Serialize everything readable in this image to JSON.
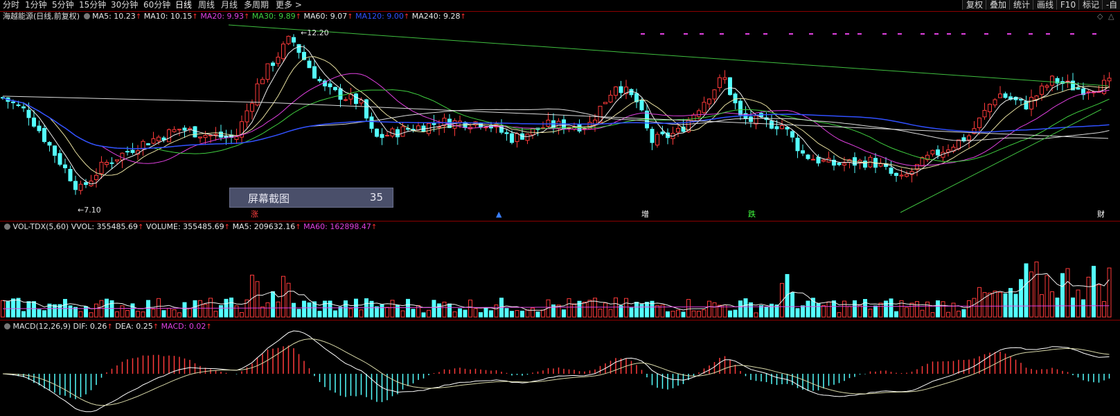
{
  "periods": [
    "分时",
    "1分钟",
    "5分钟",
    "15分钟",
    "30分钟",
    "60分钟",
    "日线",
    "周线",
    "月线",
    "多周期",
    "更多 >"
  ],
  "right_buttons": [
    "复权",
    "叠加",
    "统计",
    "画线",
    "F10",
    "标记",
    "-自"
  ],
  "price_legend": {
    "title": "海越能源(日线,前复权)",
    "ma": [
      {
        "label": "MA5: 10.23",
        "color": "#e8e8e8"
      },
      {
        "label": "MA10: 10.15",
        "color": "#e8e8e8"
      },
      {
        "label": "MA20: 9.93",
        "color": "#e040e0"
      },
      {
        "label": "MA30: 9.89",
        "color": "#40d040"
      },
      {
        "label": "MA60: 9.07",
        "color": "#e8e8e8"
      },
      {
        "label": "MA120: 9.00",
        "color": "#3050ff"
      },
      {
        "label": "MA240: 9.28",
        "color": "#e8e8e8"
      }
    ]
  },
  "high_label": "12.20",
  "low_label": "7.10",
  "screenshot_overlay": {
    "text": "屏幕截图",
    "number": "35"
  },
  "events": [
    {
      "label": "涨",
      "color": "#ff4040"
    },
    {
      "label": "▲",
      "color": "#3a7fff"
    },
    {
      "label": "增",
      "color": "#ffffff"
    },
    {
      "label": "跌",
      "color": "#40ff40"
    },
    {
      "label": "财",
      "color": "#ffffff"
    }
  ],
  "vol_legend": {
    "title": "VOL-TDX(5,60)",
    "items": [
      {
        "label": "VVOL: 355485.69",
        "color": "#e8e8e8"
      },
      {
        "label": "VOLUME: 355485.69",
        "color": "#e8e8e8"
      },
      {
        "label": "MA5: 209632.16",
        "color": "#e8e8e8"
      },
      {
        "label": "MA60: 162898.47",
        "color": "#e040e0"
      }
    ]
  },
  "macd_legend": {
    "title": "MACD(12,26,9)",
    "items": [
      {
        "label": "DIF: 0.26",
        "color": "#e8e8e8"
      },
      {
        "label": "DEA: 0.25",
        "color": "#e8e8e8"
      },
      {
        "label": "MACD: 0.02",
        "color": "#e040e0"
      }
    ]
  },
  "colors": {
    "up": "#ff3a3a",
    "down": "#54ffff",
    "grid": "#8b0000",
    "dif": "#ffffff",
    "dea": "#e8e8e8"
  }
}
